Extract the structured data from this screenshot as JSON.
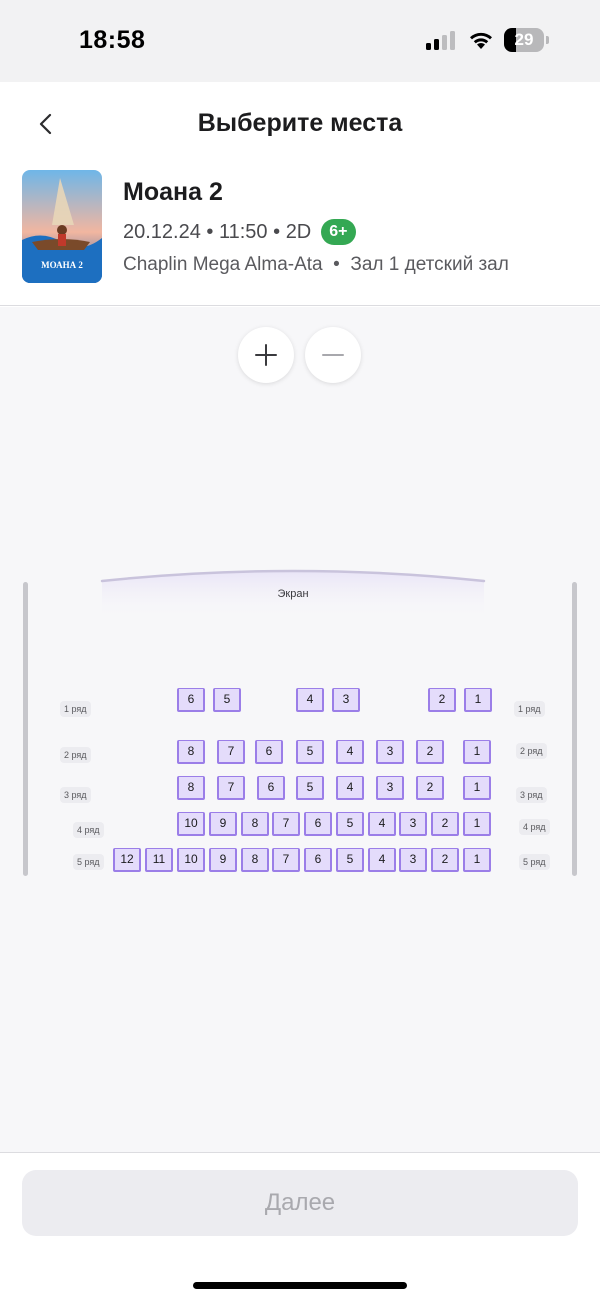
{
  "status_bar": {
    "time": "18:58",
    "battery_percent": "29",
    "battery_level": 0.29
  },
  "header": {
    "title": "Выберите места",
    "back_icon": "chevron-left-icon"
  },
  "movie": {
    "title": "Моана 2",
    "date": "20.12.24",
    "time": "11:50",
    "format": "2D",
    "age_rating": "6+",
    "cinema": "Chaplin Mega Alma-Ata",
    "hall": "Зал 1 детский зал",
    "poster_title": "МОАНА 2"
  },
  "zoom": {
    "in_icon": "plus-icon",
    "out_icon": "minus-icon"
  },
  "hall_map": {
    "screen_label": "Экран",
    "rows": [
      {
        "label": "1 ряд",
        "seats": [
          "6",
          "5",
          "4",
          "3",
          "2",
          "1"
        ]
      },
      {
        "label": "2 ряд",
        "seats": [
          "8",
          "7",
          "6",
          "5",
          "4",
          "3",
          "2",
          "1"
        ]
      },
      {
        "label": "3 ряд",
        "seats": [
          "8",
          "7",
          "6",
          "5",
          "4",
          "3",
          "2",
          "1"
        ]
      },
      {
        "label": "4 ряд",
        "seats": [
          "10",
          "9",
          "8",
          "7",
          "6",
          "5",
          "4",
          "3",
          "2",
          "1"
        ]
      },
      {
        "label": "5 ряд",
        "seats": [
          "12",
          "11",
          "10",
          "9",
          "8",
          "7",
          "6",
          "5",
          "4",
          "3",
          "2",
          "1"
        ]
      }
    ]
  },
  "footer": {
    "next_label": "Далее"
  },
  "colors": {
    "seat_fill": "#e4dcfb",
    "seat_border": "#9b7ee8",
    "age_badge": "#34a853"
  }
}
